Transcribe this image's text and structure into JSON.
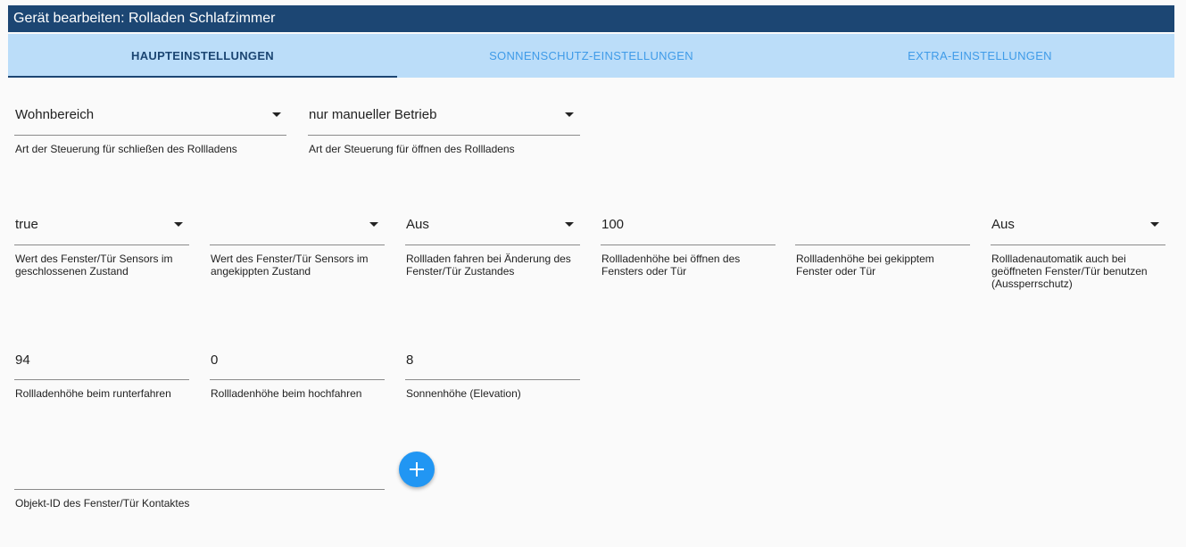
{
  "dialog": {
    "title": "Gerät bearbeiten: Rolladen Schlafzimmer"
  },
  "tabs": [
    {
      "label": "HAUPTEINSTELLUNGEN"
    },
    {
      "label": "SONNENSCHUTZ-EINSTELLUNGEN"
    },
    {
      "label": "EXTRA-EINSTELLUNGEN"
    }
  ],
  "row1": {
    "close_control": {
      "value": "Wohnbereich",
      "label": "Art der Steuerung für schließen des Rollladens"
    },
    "open_control": {
      "value": "nur manueller Betrieb",
      "label": "Art der Steuerung für öffnen des Rollladens"
    }
  },
  "row2": {
    "sensor_closed": {
      "value": "true",
      "label": "Wert des Fenster/Tür Sensors im geschlossenen Zustand"
    },
    "sensor_tilted": {
      "value": "",
      "label": "Wert des Fenster/Tür Sensors im angekippten Zustand"
    },
    "drive_on_change": {
      "value": "Aus",
      "label": "Rollladen fahren bei Änderung des Fenster/Tür Zustandes"
    },
    "height_open": {
      "value": "100",
      "label": "Rollladenhöhe bei öffnen des Fensters oder Tür"
    },
    "height_tilted": {
      "value": "",
      "label": "Rollladenhöhe bei gekipptem Fenster oder Tür"
    },
    "lockout": {
      "value": "Aus",
      "label": "Rollladenautomatik auch bei geöffneten Fenster/Tür benutzen (Aussperrschutz)"
    }
  },
  "row3": {
    "height_down": {
      "value": "94",
      "label": "Rollladenhöhe beim runterfahren"
    },
    "height_up": {
      "value": "0",
      "label": "Rollladenhöhe beim hochfahren"
    },
    "elevation": {
      "value": "8",
      "label": "Sonnenhöhe (Elevation)"
    }
  },
  "row4": {
    "contact_id": {
      "value": "",
      "label": "Objekt-ID des Fenster/Tür Kontaktes"
    }
  },
  "colors": {
    "titlebar": "#1c4673",
    "tabbar": "#bbddf9",
    "tab_inactive": "#3f9be8",
    "fab": "#2196f3"
  },
  "icons": {
    "fab": "plus-icon",
    "select": "dropdown-arrow-icon"
  }
}
